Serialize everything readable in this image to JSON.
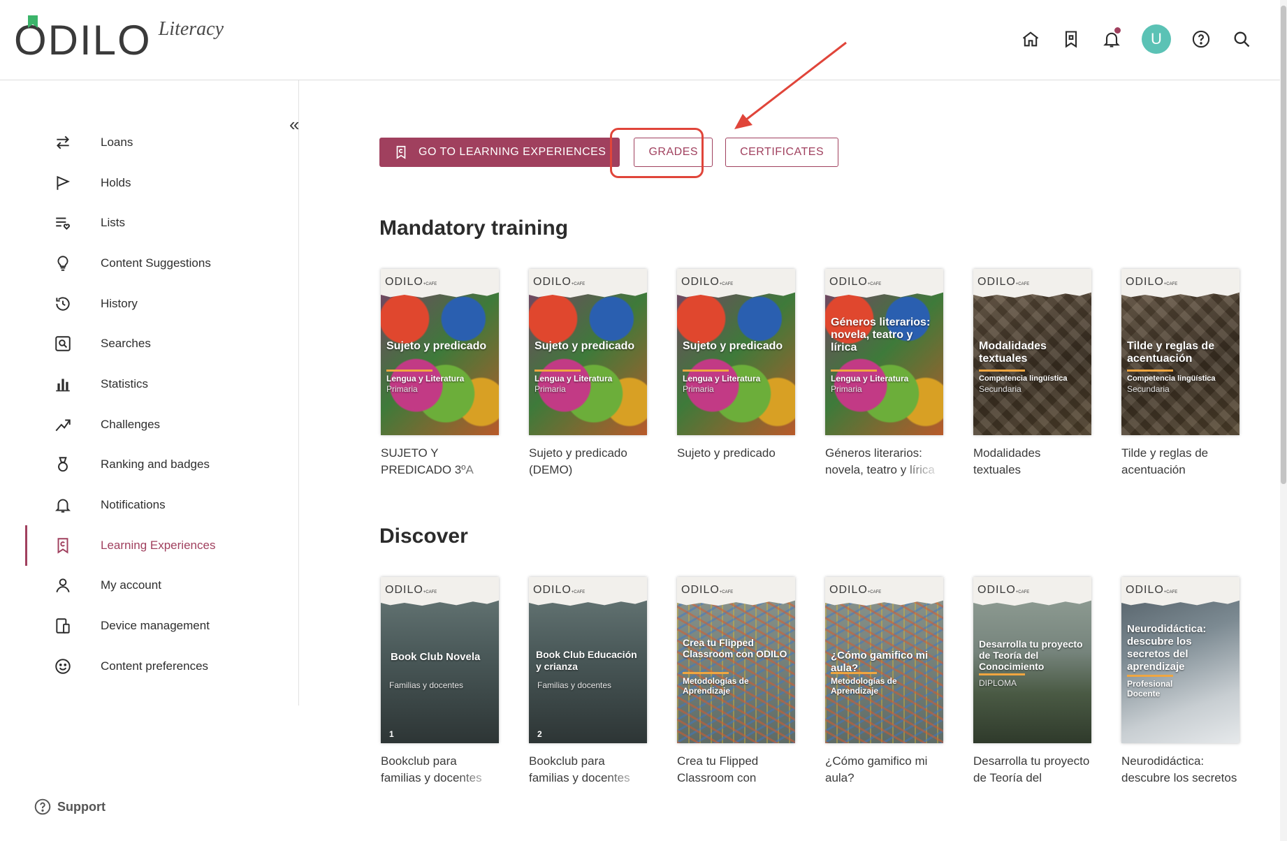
{
  "app": {
    "brand": "ODILO",
    "brand_sub": "Literacy",
    "accent_color": "#a0405e",
    "avatar_initial": "U"
  },
  "header_icons": [
    "home-icon",
    "bookmark-icon",
    "bell-icon",
    "avatar",
    "help-icon",
    "search-icon"
  ],
  "sidebar": {
    "collapse_label": "«",
    "items": [
      {
        "label": "Loans",
        "icon": "swap-arrows-icon"
      },
      {
        "label": "Holds",
        "icon": "flag-icon"
      },
      {
        "label": "Lists",
        "icon": "list-heart-icon"
      },
      {
        "label": "Content Suggestions",
        "icon": "lightbulb-icon"
      },
      {
        "label": "History",
        "icon": "history-icon"
      },
      {
        "label": "Searches",
        "icon": "search-box-icon"
      },
      {
        "label": "Statistics",
        "icon": "bar-chart-icon"
      },
      {
        "label": "Challenges",
        "icon": "climb-icon"
      },
      {
        "label": "Ranking and badges",
        "icon": "medal-icon"
      },
      {
        "label": "Notifications",
        "icon": "bell-icon"
      },
      {
        "label": "Learning Experiences",
        "icon": "learning-bookmark-icon",
        "active": true
      },
      {
        "label": "My account",
        "icon": "user-icon"
      },
      {
        "label": "Device management",
        "icon": "devices-icon"
      },
      {
        "label": "Content preferences",
        "icon": "smile-icon"
      }
    ],
    "support_label": "Support"
  },
  "actions": {
    "go_to_learning": "GO TO LEARNING EXPERIENCES",
    "grades": "GRADES",
    "certificates": "CERTIFICATES"
  },
  "sections": {
    "mandatory": {
      "title": "Mandatory training",
      "books": [
        {
          "caption": "SUJETO Y PREDICADO 3ºA",
          "cover_title": "Sujeto y predicado",
          "cover_sub": "Lengua y Literatura",
          "cover_sub2": "Primaria",
          "art": "letters"
        },
        {
          "caption": "Sujeto y predicado (DEMO)",
          "cover_title": "Sujeto y predicado",
          "cover_sub": "Lengua y Literatura",
          "cover_sub2": "Primaria",
          "art": "letters"
        },
        {
          "caption": "Sujeto y predicado",
          "cover_title": "Sujeto y predicado",
          "cover_sub": "Lengua y Literatura",
          "cover_sub2": "Primaria",
          "art": "letters"
        },
        {
          "caption": "Géneros literarios: novela, teatro y lírica",
          "cover_title": "Géneros literarios: novela, teatro y lírica",
          "cover_sub": "Lengua y Literatura",
          "cover_sub2": "Primaria",
          "art": "letters"
        },
        {
          "caption": "Modalidades textuales",
          "cover_title": "Modalidades textuales",
          "cover_sub": "Competencia lingüística",
          "cover_sub2": "Secundaria",
          "art": "wood"
        },
        {
          "caption": "Tilde y reglas de acentuación",
          "cover_title": "Tilde y reglas de acentuación",
          "cover_sub": "Competencia lingüística",
          "cover_sub2": "Secundaria",
          "art": "wood"
        }
      ]
    },
    "discover": {
      "title": "Discover",
      "books": [
        {
          "caption": "Bookclub para familias y docentes",
          "cover_title": "Book Club Novela",
          "cover_sub": "",
          "cover_sub2": "Familias y docentes",
          "num": "1",
          "art": "book"
        },
        {
          "caption": "Bookclub para familias y docentes",
          "cover_title": "Book Club Educación y crianza",
          "cover_sub": "",
          "cover_sub2": "Familias y docentes",
          "num": "2",
          "art": "book"
        },
        {
          "caption": "Crea tu Flipped Classroom con ODILO",
          "cover_title": "Crea tu Flipped Classroom con ODILO",
          "cover_sub": "Metodologías de Aprendizaje",
          "cover_sub2": "",
          "art": "yarn"
        },
        {
          "caption": "¿Cómo gamifico mi aula?",
          "cover_title": "¿Cómo gamifico mi aula?",
          "cover_sub": "Metodologías de Aprendizaje",
          "cover_sub2": "",
          "art": "yarn"
        },
        {
          "caption": "Desarrolla tu proyecto de Teoría del Conocimiento",
          "cover_title": "Desarrolla tu proyecto de Teoría del Conocimiento",
          "cover_sub": "",
          "cover_sub2": "DIPLOMA",
          "art": "grad"
        },
        {
          "caption": "Neurodidáctica: descubre los secretos del aprendizaje",
          "cover_title": "Neurodidáctica: descubre los secretos del aprendizaje",
          "cover_sub": "Profesional Docente",
          "cover_sub2": "",
          "art": "class"
        }
      ]
    }
  }
}
